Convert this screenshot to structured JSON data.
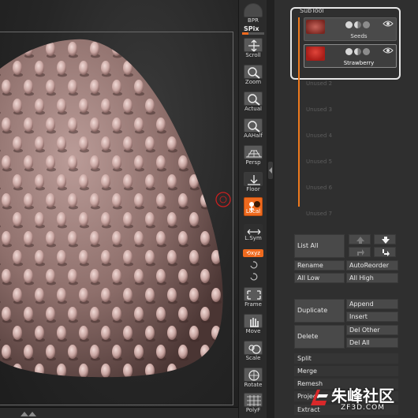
{
  "toolbar": {
    "bpr_label": "BPR",
    "spix_label": "SPix",
    "spix_level": 0.3,
    "scroll_label": "Scroll",
    "zoom_label": "Zoom",
    "actual_label": "Actual",
    "aahalf_label": "AAHalf",
    "persp_label": "Persp",
    "floor_label": "Floor",
    "local_label": "Local",
    "lsym_label": "L.Sym",
    "xyz_label": "⟲xyz",
    "frame_label": "Frame",
    "move_label": "Move",
    "scale_label": "Scale",
    "rotate_label": "Rotate",
    "polyf_label": "PolyF"
  },
  "subtool": {
    "title": "SubTool",
    "items": [
      {
        "name": "Seeds",
        "selected": false
      },
      {
        "name": "Strawberry",
        "selected": true
      }
    ],
    "unused": [
      "Unused 2",
      "Unused 3",
      "Unused 4",
      "Unused 5",
      "Unused 6",
      "Unused 7"
    ]
  },
  "buttons": {
    "list_all": "List All",
    "rename": "Rename",
    "auto_reorder": "AutoReorder",
    "all_low": "All Low",
    "all_high": "All High",
    "duplicate": "Duplicate",
    "append": "Append",
    "insert": "Insert",
    "delete": "Delete",
    "del_other": "Del Other",
    "del_all": "Del All",
    "split": "Split",
    "merge": "Merge",
    "remesh": "Remesh",
    "project": "Project",
    "extract": "Extract"
  },
  "watermark": {
    "title": "朱峰社区",
    "subtitle": "ZF3D.COM"
  },
  "colors": {
    "accent": "#ef6a1e",
    "model": "#9a7a76"
  },
  "icons": [
    "bpr-icon",
    "scroll-icon",
    "zoom-icon",
    "actual-icon",
    "aahalf-icon",
    "persp-icon",
    "floor-icon",
    "local-icon",
    "lsym-icon",
    "frame-icon",
    "move-icon",
    "scale-icon",
    "rotate-icon",
    "polyf-icon",
    "eye-icon",
    "arrow-up-icon",
    "arrow-down-icon"
  ]
}
